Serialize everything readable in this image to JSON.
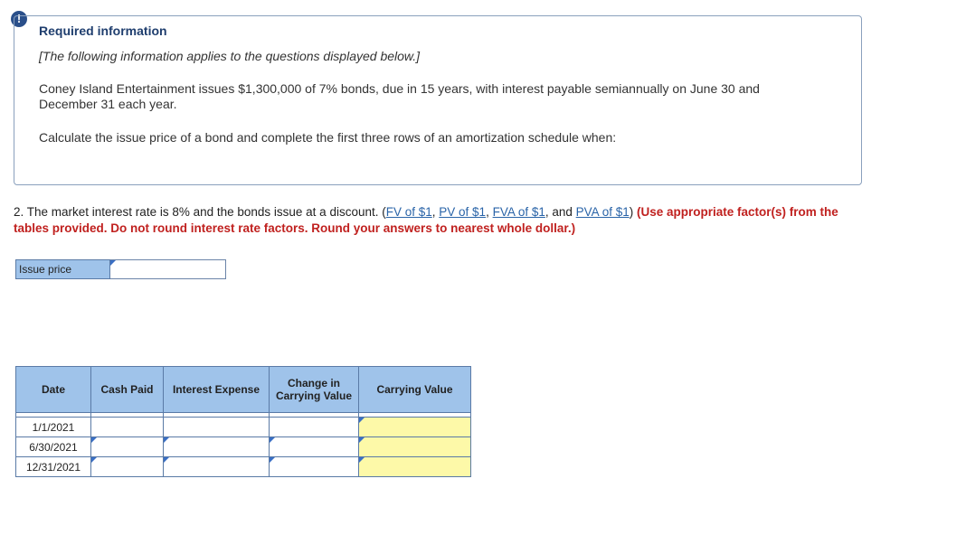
{
  "badge": "!",
  "info": {
    "title": "Required information",
    "note": "[The following information applies to the questions displayed below.]",
    "body": "Coney Island Entertainment issues $1,300,000 of 7% bonds, due in 15 years, with interest payable semiannually on June 30 and December 31 each year.",
    "instruction": "Calculate the issue price of a bond and complete the first three rows of an amortization schedule when:"
  },
  "question": {
    "prefix": "2. The market interest rate is 8% and the bonds issue at a discount. (",
    "links": [
      "FV of $1",
      "PV of $1",
      "FVA of $1",
      "PVA of $1"
    ],
    "sep1": ", ",
    "sep2": ", ",
    "sep3": ", and ",
    "suffix": ") ",
    "red_note": "(Use appropriate factor(s) from the tables provided. Do not round interest rate factors. Round your answers to nearest whole dollar.)"
  },
  "issue_price": {
    "label": "Issue price",
    "value": ""
  },
  "schedule": {
    "headers": [
      "Date",
      "Cash Paid",
      "Interest Expense",
      "Change in Carrying Value",
      "Carrying Value"
    ],
    "rows": [
      {
        "date": "1/1/2021"
      },
      {
        "date": "6/30/2021"
      },
      {
        "date": "12/31/2021"
      }
    ]
  }
}
